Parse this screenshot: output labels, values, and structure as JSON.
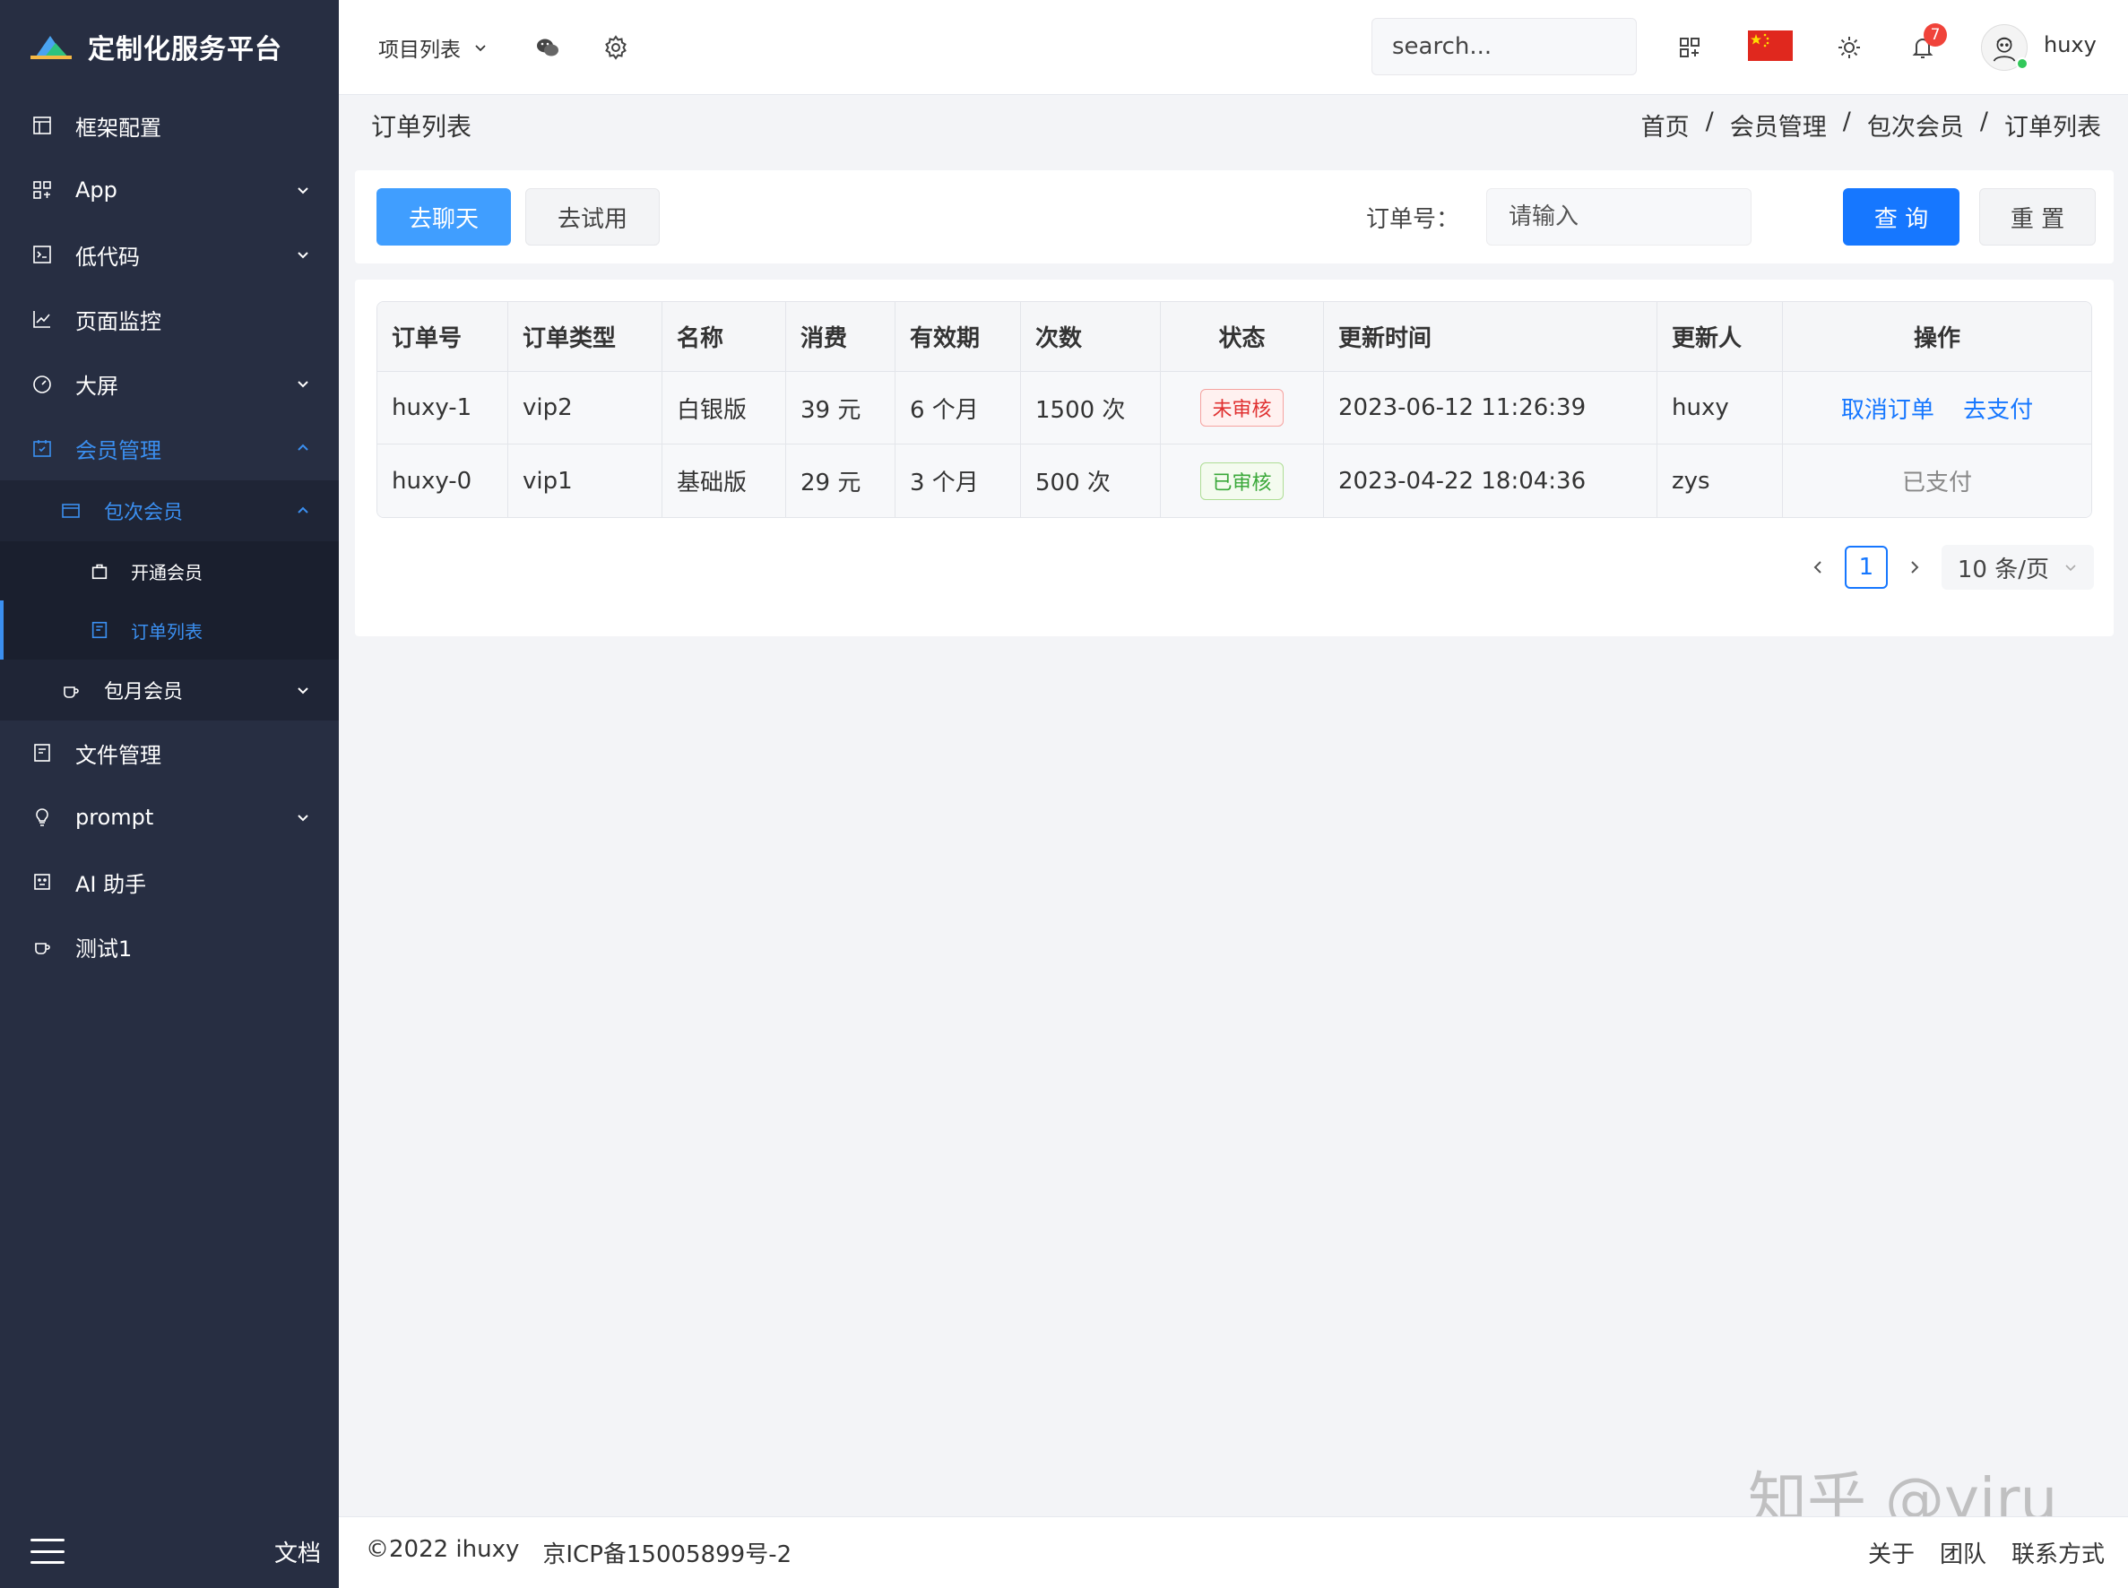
{
  "app": {
    "title": "定制化服务平台"
  },
  "sidebar": {
    "items": [
      {
        "label": "框架配置"
      },
      {
        "label": "App"
      },
      {
        "label": "低代码"
      },
      {
        "label": "页面监控"
      },
      {
        "label": "大屏"
      },
      {
        "label": "会员管理"
      },
      {
        "label": "文件管理"
      },
      {
        "label": "prompt"
      },
      {
        "label": "AI 助手"
      },
      {
        "label": "测试1"
      }
    ],
    "member": {
      "per_use": "包次会员",
      "open": "开通会员",
      "orders": "订单列表",
      "monthly": "包月会员"
    },
    "docs": "文档"
  },
  "topbar": {
    "project": "项目列表",
    "search_placeholder": "search...",
    "notification_count": "7",
    "username": "huxy"
  },
  "page": {
    "title": "订单列表",
    "breadcrumb": [
      "首页",
      "会员管理",
      "包次会员",
      "订单列表"
    ]
  },
  "toolbar": {
    "chat": "去聊天",
    "trial": "去试用",
    "order_label": "订单号：",
    "order_placeholder": "请输入",
    "query": "查 询",
    "reset": "重 置"
  },
  "table": {
    "columns": [
      "订单号",
      "订单类型",
      "名称",
      "消费",
      "有效期",
      "次数",
      "状态",
      "更新时间",
      "更新人",
      "操作"
    ],
    "rows": [
      {
        "id": "huxy-1",
        "type": "vip2",
        "name": "白银版",
        "cost": "39 元",
        "validity": "6 个月",
        "count": "1500 次",
        "status": "未审核",
        "updated": "2023-06-12 11:26:39",
        "updater": "huxy",
        "actions": [
          "取消订单",
          "去支付"
        ]
      },
      {
        "id": "huxy-0",
        "type": "vip1",
        "name": "基础版",
        "cost": "29 元",
        "validity": "3 个月",
        "count": "500 次",
        "status": "已审核",
        "updated": "2023-04-22 18:04:36",
        "updater": "zys",
        "actions_text": "已支付"
      }
    ]
  },
  "pagination": {
    "current": "1",
    "page_size": "10 条/页"
  },
  "footer": {
    "copyright": "©2022 ihuxy",
    "icp": "京ICP备15005899号-2",
    "links": [
      "关于",
      "团队",
      "联系方式"
    ]
  },
  "watermark": "知乎 @yiru",
  "colors": {
    "sidebar_bg": "#272e42",
    "accent": "#1677ff",
    "active_menu": "#3b8ff0"
  }
}
